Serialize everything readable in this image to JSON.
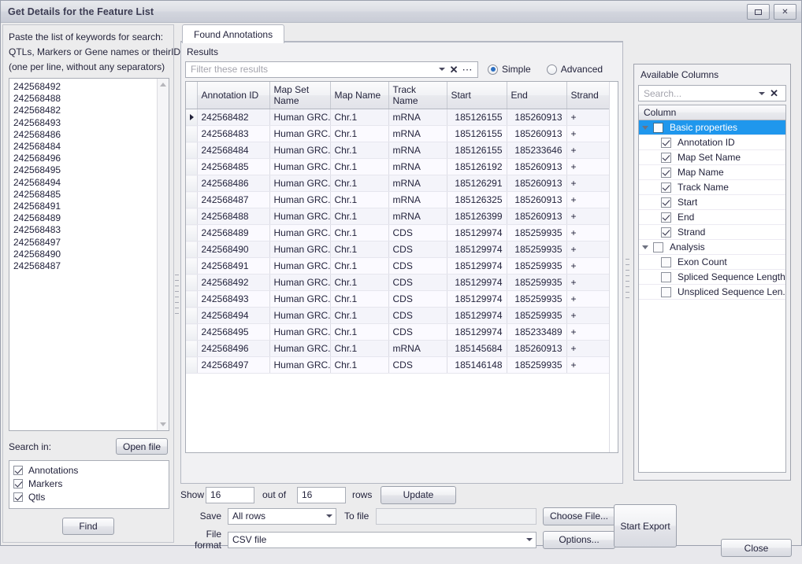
{
  "window": {
    "title": "Get Details for the Feature List",
    "maximize_label": "maximize-icon",
    "close_label": "✕"
  },
  "left_panel": {
    "instruction_line1": "Paste the list of keywords for search:",
    "instruction_line2": "QTLs, Markers or Gene names or theirIDs",
    "instruction_line3": "(one per line, without any separators)",
    "keywords": "242568492\n242568488\n242568482\n242568493\n242568486\n242568484\n242568496\n242568495\n242568494\n242568485\n242568491\n242568489\n242568483\n242568497\n242568490\n242568487",
    "search_in_label": "Search in:",
    "open_file_label": "Open file",
    "search_in_options": [
      {
        "label": "Annotations",
        "checked": true
      },
      {
        "label": "Markers",
        "checked": true
      },
      {
        "label": "Qtls",
        "checked": true
      }
    ],
    "find_label": "Find"
  },
  "center_panel": {
    "tab_label": "Found Annotations",
    "results_caption": "Results",
    "filter_placeholder": "Filter these results",
    "filter_value": "",
    "clear_icon": "✕",
    "more_icon": "⋯",
    "mode_simple": "Simple",
    "mode_advanced": "Advanced",
    "mode_selected": "Simple"
  },
  "table": {
    "columns": [
      "Annotation ID",
      "Map Set Name",
      "Map Name",
      "Track Name",
      "Start",
      "End",
      "Strand"
    ],
    "rows": [
      {
        "id": "242568482",
        "map_set": "Human GRC...",
        "map": "Chr.1",
        "track": "mRNA",
        "start": "185126155",
        "end": "185260913",
        "strand": "+",
        "selected": true
      },
      {
        "id": "242568483",
        "map_set": "Human GRC...",
        "map": "Chr.1",
        "track": "mRNA",
        "start": "185126155",
        "end": "185260913",
        "strand": "+"
      },
      {
        "id": "242568484",
        "map_set": "Human GRC...",
        "map": "Chr.1",
        "track": "mRNA",
        "start": "185126155",
        "end": "185233646",
        "strand": "+"
      },
      {
        "id": "242568485",
        "map_set": "Human GRC...",
        "map": "Chr.1",
        "track": "mRNA",
        "start": "185126192",
        "end": "185260913",
        "strand": "+"
      },
      {
        "id": "242568486",
        "map_set": "Human GRC...",
        "map": "Chr.1",
        "track": "mRNA",
        "start": "185126291",
        "end": "185260913",
        "strand": "+"
      },
      {
        "id": "242568487",
        "map_set": "Human GRC...",
        "map": "Chr.1",
        "track": "mRNA",
        "start": "185126325",
        "end": "185260913",
        "strand": "+"
      },
      {
        "id": "242568488",
        "map_set": "Human GRC...",
        "map": "Chr.1",
        "track": "mRNA",
        "start": "185126399",
        "end": "185260913",
        "strand": "+"
      },
      {
        "id": "242568489",
        "map_set": "Human GRC...",
        "map": "Chr.1",
        "track": "CDS",
        "start": "185129974",
        "end": "185259935",
        "strand": "+"
      },
      {
        "id": "242568490",
        "map_set": "Human GRC...",
        "map": "Chr.1",
        "track": "CDS",
        "start": "185129974",
        "end": "185259935",
        "strand": "+"
      },
      {
        "id": "242568491",
        "map_set": "Human GRC...",
        "map": "Chr.1",
        "track": "CDS",
        "start": "185129974",
        "end": "185259935",
        "strand": "+"
      },
      {
        "id": "242568492",
        "map_set": "Human GRC...",
        "map": "Chr.1",
        "track": "CDS",
        "start": "185129974",
        "end": "185259935",
        "strand": "+"
      },
      {
        "id": "242568493",
        "map_set": "Human GRC...",
        "map": "Chr.1",
        "track": "CDS",
        "start": "185129974",
        "end": "185259935",
        "strand": "+"
      },
      {
        "id": "242568494",
        "map_set": "Human GRC...",
        "map": "Chr.1",
        "track": "CDS",
        "start": "185129974",
        "end": "185259935",
        "strand": "+"
      },
      {
        "id": "242568495",
        "map_set": "Human GRC...",
        "map": "Chr.1",
        "track": "CDS",
        "start": "185129974",
        "end": "185233489",
        "strand": "+"
      },
      {
        "id": "242568496",
        "map_set": "Human GRC...",
        "map": "Chr.1",
        "track": "mRNA",
        "start": "185145684",
        "end": "185260913",
        "strand": "+"
      },
      {
        "id": "242568497",
        "map_set": "Human GRC...",
        "map": "Chr.1",
        "track": "CDS",
        "start": "185146148",
        "end": "185259935",
        "strand": "+"
      }
    ]
  },
  "right_panel": {
    "title": "Available Columns",
    "search_placeholder": "Search...",
    "search_value": "",
    "clear_icon": "✕",
    "column_header": "Column",
    "groups": [
      {
        "label": "Basic properties",
        "checked": false,
        "selected": true,
        "expanded": true,
        "items": [
          {
            "label": "Annotation ID",
            "checked": true
          },
          {
            "label": "Map Set Name",
            "checked": true
          },
          {
            "label": "Map Name",
            "checked": true
          },
          {
            "label": "Track Name",
            "checked": true
          },
          {
            "label": "Start",
            "checked": true
          },
          {
            "label": "End",
            "checked": true
          },
          {
            "label": "Strand",
            "checked": true
          }
        ]
      },
      {
        "label": "Analysis",
        "checked": false,
        "selected": false,
        "expanded": true,
        "items": [
          {
            "label": "Exon Count",
            "checked": false
          },
          {
            "label": "Spliced Sequence Length",
            "checked": false
          },
          {
            "label": "Unspliced Sequence Len...",
            "checked": false
          }
        ]
      }
    ]
  },
  "bottom": {
    "show_label": "Show",
    "show_value": "16",
    "out_of_label": "out of",
    "total_value": "16",
    "rows_label": "rows",
    "update_label": "Update",
    "save_label": "Save",
    "save_value": "All rows",
    "to_file_label": "To file",
    "to_file_value": "",
    "choose_file_label": "Choose File...",
    "file_format_label": "File format",
    "file_format_value": "CSV file",
    "options_label": "Options...",
    "start_export_label": "Start Export",
    "close_label": "Close"
  },
  "colors": {
    "accent": "#1f97ed",
    "radio_dot": "#2d6fc1",
    "row_even": "#f4f4fa",
    "row_odd": "#fbfaff"
  }
}
